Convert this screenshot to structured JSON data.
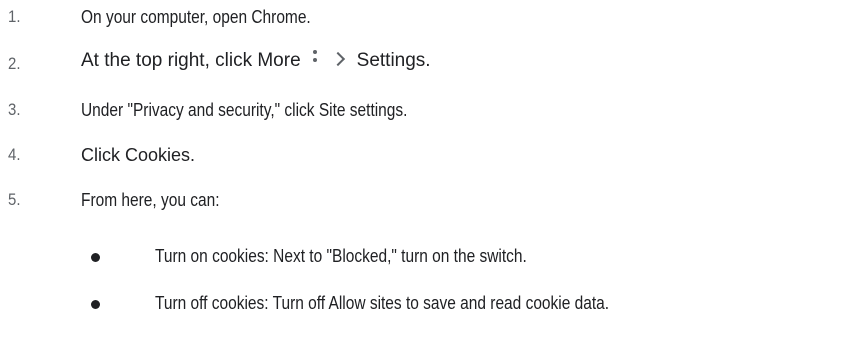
{
  "steps": [
    {
      "number": "1.",
      "text": "On your computer, open Chrome."
    },
    {
      "number": "2.",
      "prefix": "At the top right, click More",
      "more_icon": "more-vert-icon",
      "chevron_icon": "chevron-right-icon",
      "suffix": "Settings."
    },
    {
      "number": "3.",
      "text": "Under \"Privacy and security,\" click Site settings."
    },
    {
      "number": "4.",
      "text": "Click Cookies."
    },
    {
      "number": "5.",
      "text": "From here, you can:"
    }
  ],
  "bullets": [
    {
      "text": "Turn on cookies: Next to \"Blocked,\" turn on the switch."
    },
    {
      "text": "Turn off cookies: Turn off Allow sites to save and read cookie data."
    }
  ]
}
